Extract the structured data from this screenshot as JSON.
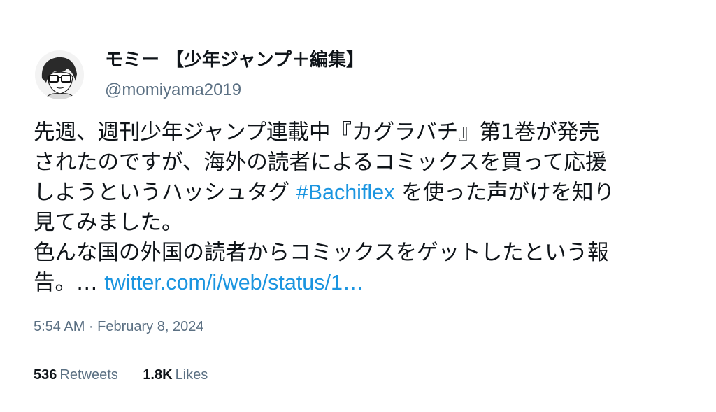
{
  "author": {
    "display_name": "モミー 【少年ジャンプ＋編集】",
    "handle": "@momiyama2019",
    "avatar_icon": "manga-avatar-icon"
  },
  "tweet": {
    "lines": [
      [
        {
          "text": "先週、週刊少年ジャンプ連載中『カグラバチ』第1巻が発売"
        }
      ],
      [
        {
          "text": "されたのですが、海外の読者によるコミックスを買って応援"
        }
      ],
      [
        {
          "text": "しようというハッシュタグ "
        },
        {
          "text": "#Bachiflex",
          "link": true,
          "name": "hashtag-link"
        },
        {
          "text": " を使った声がけを知り"
        }
      ],
      [
        {
          "text": "見てみました。"
        }
      ],
      [
        {
          "text": "色んな国の外国の読者からコミックスをゲットしたという報"
        }
      ],
      [
        {
          "text": "告。… "
        },
        {
          "text": "twitter.com/i/web/status/1…",
          "link": true,
          "name": "tweet-url-link"
        }
      ]
    ],
    "link_color": "#1b95e0"
  },
  "timestamp": "5:54 AM · February 8, 2024",
  "stats": {
    "retweets_count": "536",
    "retweets_label": "Retweets",
    "likes_count": "1.8K",
    "likes_label": "Likes"
  }
}
